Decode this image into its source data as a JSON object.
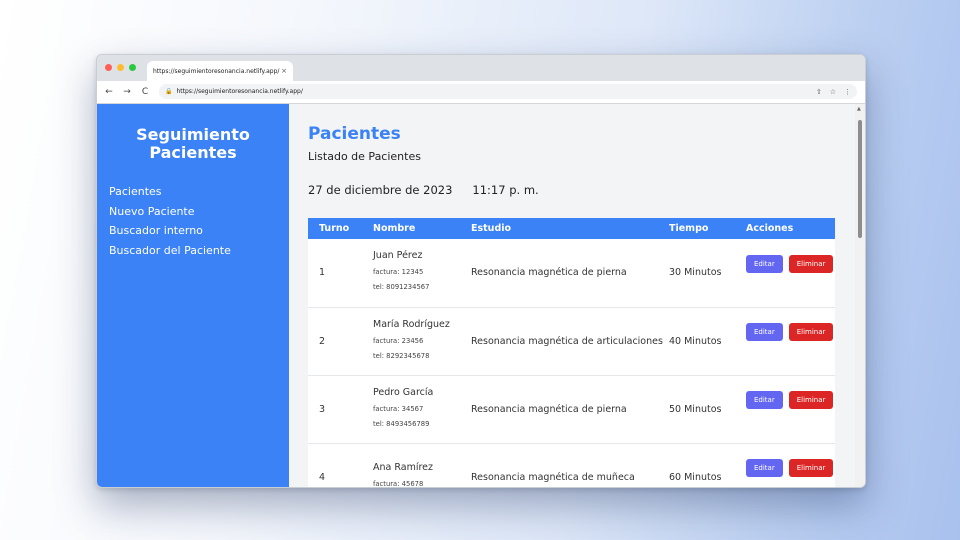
{
  "browser": {
    "tab_title": "https://seguimientoresonancia.netlify.app/",
    "url": "https://seguimientoresonancia.netlify.app/",
    "tab_close": "×",
    "icons": {
      "back": "←",
      "forward": "→",
      "reload": "C",
      "lock": "🔒",
      "share": "⇧",
      "bookmark": "☆",
      "menu": "⋮"
    }
  },
  "sidebar": {
    "title_line1": "Seguimiento",
    "title_line2": "Pacientes",
    "items": [
      {
        "label": "Pacientes"
      },
      {
        "label": "Nuevo Paciente"
      },
      {
        "label": "Buscador interno"
      },
      {
        "label": "Buscador del Paciente"
      }
    ],
    "color": "#3b82f6"
  },
  "main": {
    "title": "Pacientes",
    "subtitle": "Listado de Pacientes",
    "date": "27 de diciembre de 2023",
    "time": "11:17 p. m."
  },
  "table": {
    "headers": {
      "turno": "Turno",
      "nombre": "Nombre",
      "estudio": "Estudio",
      "tiempo": "Tiempo",
      "acciones": "Acciones"
    },
    "rows": [
      {
        "turno": "1",
        "nombre": "Juan Pérez",
        "factura": "factura: 12345",
        "tel": "tel: 8091234567",
        "estudio": "Resonancia magnética de pierna",
        "tiempo": "30 Minutos",
        "edit": "Editar",
        "delete": "Eliminar"
      },
      {
        "turno": "2",
        "nombre": "María Rodríguez",
        "factura": "factura: 23456",
        "tel": "tel: 8292345678",
        "estudio": "Resonancia magnética de articulaciones",
        "tiempo": "40 Minutos",
        "edit": "Editar",
        "delete": "Eliminar"
      },
      {
        "turno": "3",
        "nombre": "Pedro García",
        "factura": "factura: 34567",
        "tel": "tel: 8493456789",
        "estudio": "Resonancia magnética de pierna",
        "tiempo": "50 Minutos",
        "edit": "Editar",
        "delete": "Eliminar"
      },
      {
        "turno": "4",
        "nombre": "Ana Ramírez",
        "factura": "factura: 45678",
        "tel": "",
        "estudio": "Resonancia magnética de muñeca",
        "tiempo": "60 Minutos",
        "edit": "Editar",
        "delete": "Eliminar"
      }
    ]
  },
  "colors": {
    "primary": "#3b82f6",
    "edit": "#6366f1",
    "delete": "#dc2626"
  }
}
